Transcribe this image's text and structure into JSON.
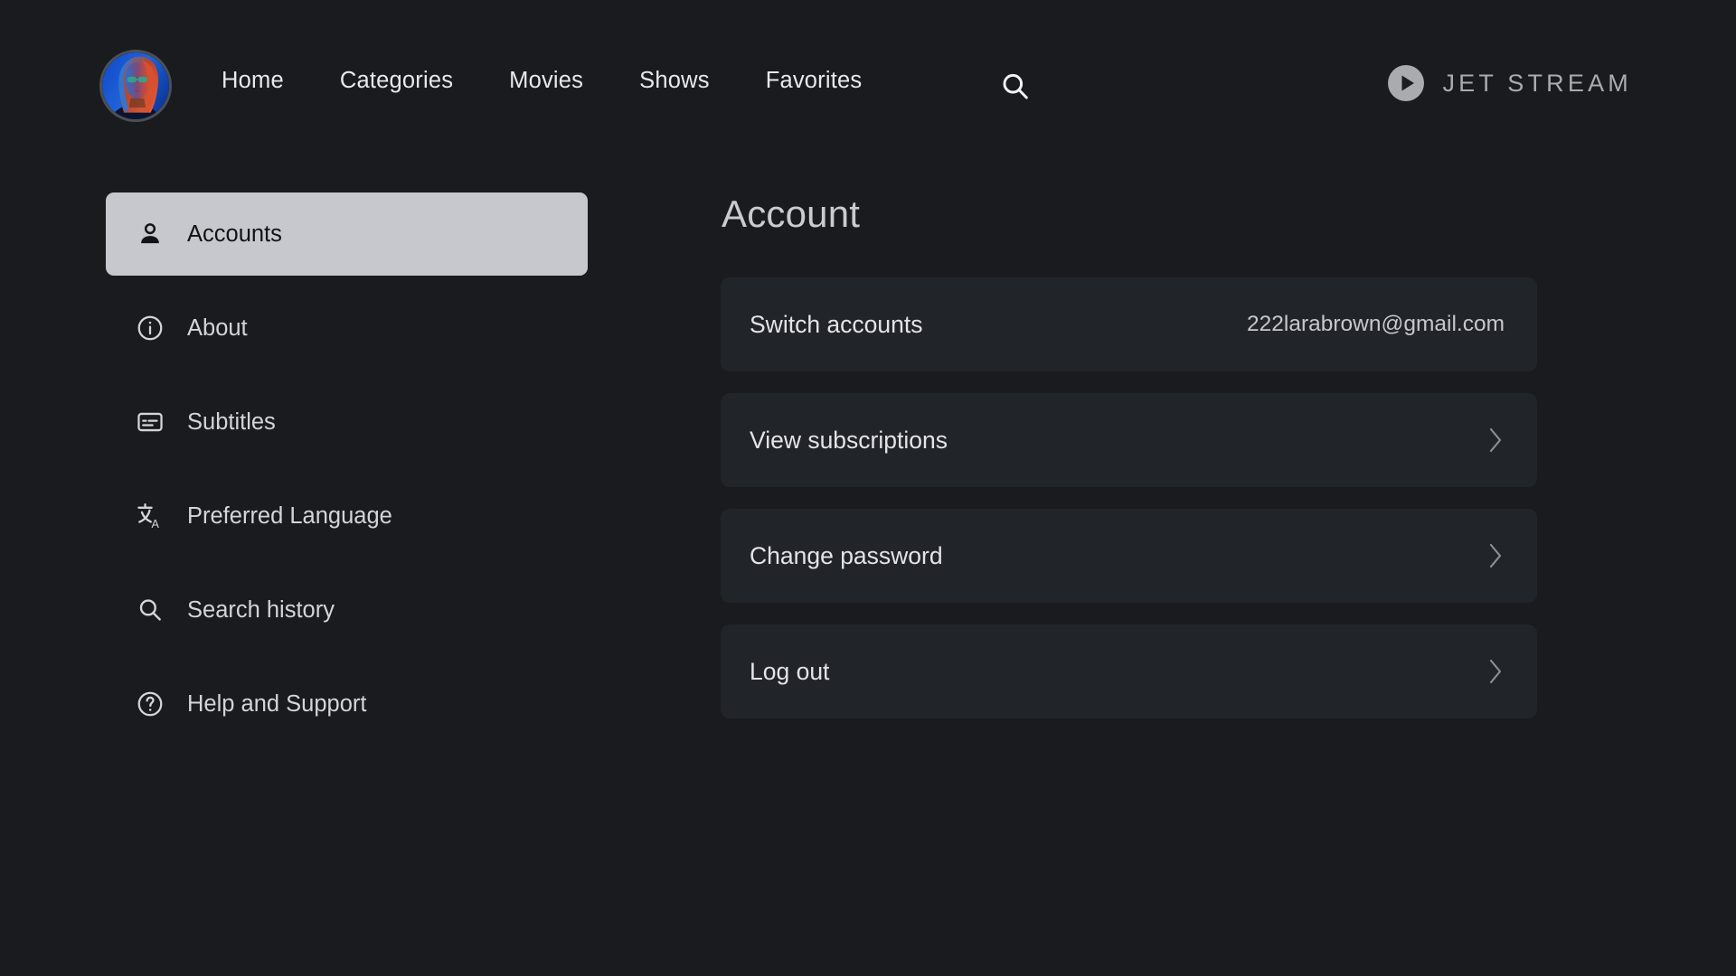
{
  "brand": {
    "name": "JET STREAM",
    "icon": "play-circle-icon",
    "color": "#a9abaf"
  },
  "nav": {
    "avatar_alt": "user-avatar",
    "links": [
      {
        "label": "Home",
        "name": "nav-link-home"
      },
      {
        "label": "Categories",
        "name": "nav-link-categories"
      },
      {
        "label": "Movies",
        "name": "nav-link-movies"
      },
      {
        "label": "Shows",
        "name": "nav-link-shows"
      },
      {
        "label": "Favorites",
        "name": "nav-link-favorites"
      }
    ],
    "search_icon": "search-icon"
  },
  "sidebar": {
    "items": [
      {
        "label": "Accounts",
        "icon": "person-icon",
        "active": true
      },
      {
        "label": "About",
        "icon": "info-circle-icon",
        "active": false
      },
      {
        "label": "Subtitles",
        "icon": "closed-captions-icon",
        "active": false
      },
      {
        "label": "Preferred Language",
        "icon": "translate-icon",
        "active": false
      },
      {
        "label": "Search history",
        "icon": "search-icon",
        "active": false
      },
      {
        "label": "Help and Support",
        "icon": "question-circle-icon",
        "active": false
      }
    ]
  },
  "main": {
    "title": "Account",
    "rows": [
      {
        "label": "Switch accounts",
        "value": "222larabrown@gmail.com",
        "chevron": false
      },
      {
        "label": "View subscriptions",
        "value": "",
        "chevron": true
      },
      {
        "label": "Change password",
        "value": "",
        "chevron": true
      },
      {
        "label": "Log out",
        "value": "",
        "chevron": true
      }
    ]
  },
  "theme": {
    "background": "#191b1e",
    "row_background": "#212429",
    "active_item_background": "#c6c8cd",
    "text_primary": "#e3e4e7",
    "text_muted": "#a9abaf"
  }
}
